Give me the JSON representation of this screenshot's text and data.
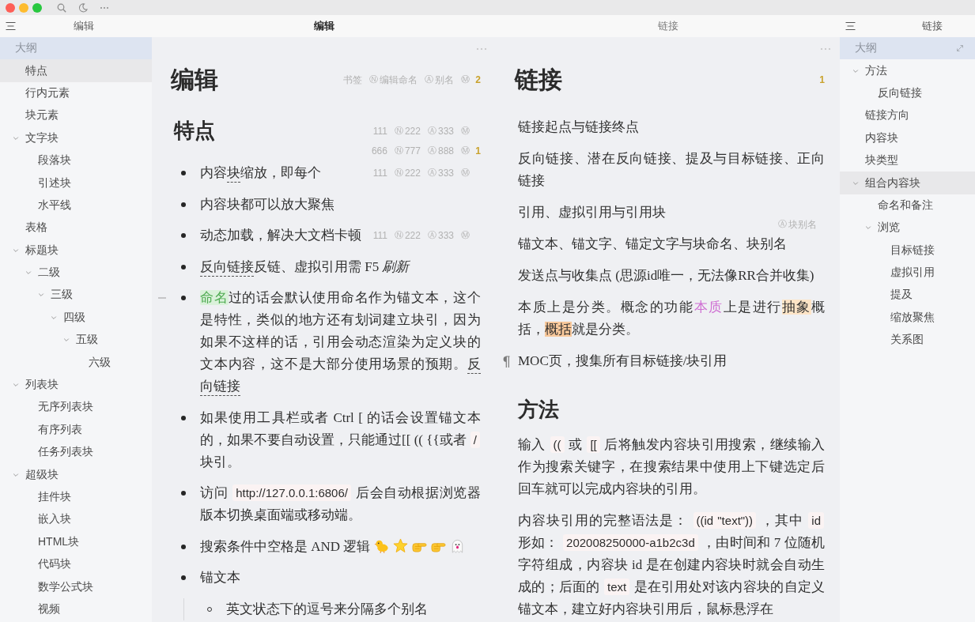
{
  "left_outline": {
    "header": "编辑",
    "title": "大纲",
    "items": [
      {
        "label": "特点",
        "selected": true
      },
      {
        "label": "行内元素",
        "selected": false
      },
      {
        "label": "块元素",
        "selected": false
      },
      {
        "label": "文字块",
        "selected": false,
        "expanded": true,
        "children": [
          {
            "label": "段落块",
            "selected": false
          },
          {
            "label": "引述块",
            "selected": false
          },
          {
            "label": "水平线",
            "selected": false
          }
        ]
      },
      {
        "label": "表格",
        "selected": false
      },
      {
        "label": "标题块",
        "selected": false,
        "expanded": true,
        "children": [
          {
            "label": "二级",
            "selected": false,
            "expanded": true,
            "children": [
              {
                "label": "三级",
                "selected": false,
                "expanded": true,
                "children": [
                  {
                    "label": "四级",
                    "selected": false,
                    "expanded": true,
                    "children": [
                      {
                        "label": "五级",
                        "selected": false,
                        "expanded": true,
                        "children": [
                          {
                            "label": "六级",
                            "selected": false
                          }
                        ]
                      }
                    ]
                  }
                ]
              }
            ]
          }
        ]
      },
      {
        "label": "列表块",
        "selected": false,
        "expanded": true,
        "children": [
          {
            "label": "无序列表块",
            "selected": false
          },
          {
            "label": "有序列表",
            "selected": false
          },
          {
            "label": "任务列表块",
            "selected": false
          }
        ]
      },
      {
        "label": "超级块",
        "selected": false,
        "expanded": true,
        "children": [
          {
            "label": "挂件块",
            "selected": false
          },
          {
            "label": "嵌入块",
            "selected": false
          },
          {
            "label": "HTML块",
            "selected": false
          },
          {
            "label": "代码块",
            "selected": false
          },
          {
            "label": "数学公式块",
            "selected": false
          },
          {
            "label": "视频",
            "selected": false
          }
        ]
      }
    ]
  },
  "editors": [
    {
      "tab": "编辑",
      "active": true,
      "title": "编辑",
      "attrs": [
        {
          "text": "书签"
        },
        {
          "glyph": "Ⓝ",
          "text": "编辑命名"
        },
        {
          "glyph": "Ⓐ",
          "text": "别名"
        },
        {
          "glyph": "Ⓜ"
        }
      ],
      "count": "2",
      "blocks": [
        {
          "kind": "heading",
          "text": "特点",
          "attrs": [
            {
              "text": "111"
            },
            {
              "glyph": "Ⓝ",
              "text": "222"
            },
            {
              "glyph": "Ⓐ",
              "text": "333"
            },
            {
              "glyph": "Ⓜ"
            }
          ]
        },
        {
          "kind": "list",
          "attrs": [
            {
              "text": "666"
            },
            {
              "glyph": "Ⓝ",
              "text": "777"
            },
            {
              "glyph": "Ⓐ",
              "text": "888"
            },
            {
              "glyph": "Ⓜ"
            }
          ],
          "count": "1",
          "items": [
            {
              "hovered": false,
              "segments": [
                {
                  "kind": "plain",
                  "text": "内容"
                },
                {
                  "kind": "ref",
                  "text": "块"
                },
                {
                  "kind": "plain",
                  "text": "缩放，即每个"
                }
              ],
              "attrs": [
                {
                  "text": "111"
                },
                {
                  "glyph": "Ⓝ",
                  "text": "222"
                },
                {
                  "glyph": "Ⓐ",
                  "text": "333"
                },
                {
                  "glyph": "Ⓜ"
                }
              ]
            },
            {
              "hovered": false,
              "text": "内容块都可以放大聚焦"
            },
            {
              "hovered": false,
              "text": "动态加载，解决大文档卡顿",
              "attrs": [
                {
                  "text": "111"
                },
                {
                  "glyph": "Ⓝ",
                  "text": "222"
                },
                {
                  "glyph": "Ⓐ",
                  "text": "333"
                },
                {
                  "glyph": "Ⓜ"
                }
              ]
            },
            {
              "hovered": false,
              "segments": [
                {
                  "kind": "ref",
                  "text": "反向链接"
                },
                {
                  "kind": "plain",
                  "text": "反链、虚拟引用需 F5 *刷新*"
                }
              ]
            },
            {
              "hovered": true,
              "segments": [
                {
                  "kind": "named",
                  "text": "命名"
                },
                {
                  "kind": "plain",
                  "text": "过的话会默认使用命名作为锚文本，这个是特性，类似的地方还有划词建立块引，因为如果不这样的话，引用会动态渲染为定义块的文本内容，这不是大部分使用场景的预期。"
                },
                {
                  "kind": "ref",
                  "text": "反向链接"
                }
              ]
            },
            {
              "hovered": false,
              "segments": [
                {
                  "kind": "plain",
                  "text": "如果使用工具栏或者 Ctrl [ 的话会设置锚文本的，如果不要自动设置，只能通过[[ (( {{或者 "
                },
                {
                  "kind": "code",
                  "text": "/"
                },
                {
                  "kind": "plain",
                  "text": " 块引。"
                }
              ]
            },
            {
              "hovered": false,
              "segments": [
                {
                  "kind": "plain",
                  "text": "访问 "
                },
                {
                  "kind": "code",
                  "text": "http://127.0.0.1:6806/"
                },
                {
                  "kind": "plain",
                  "text": " 后会自动根据浏览器版本切换桌面端或移动端。"
                }
              ]
            },
            {
              "hovered": false,
              "segments": [
                {
                  "kind": "plain",
                  "text": "搜索条件中空格是 AND 逻辑"
                },
                {
                  "kind": "chick"
                },
                {
                  "kind": "star"
                },
                {
                  "kind": "hand"
                },
                {
                  "kind": "hand"
                },
                {
                  "kind": "ghost"
                }
              ]
            },
            {
              "hovered": false,
              "text": "锚文本",
              "children": [
                {
                  "hovered": false,
                  "text": "英文状态下的逗号来分隔多个别名"
                }
              ]
            }
          ]
        }
      ]
    },
    {
      "tab": "链接",
      "active": false,
      "title": "链接",
      "count": "1",
      "blocks": [
        {
          "kind": "paragraph",
          "hovered": false,
          "text": "链接起点与链接终点"
        },
        {
          "kind": "paragraph",
          "hovered": false,
          "text": "反向链接、潜在反向链接、提及与目标链接、正向链接"
        },
        {
          "kind": "paragraph",
          "hovered": false,
          "text": "引用、虚拟引用与引用块"
        },
        {
          "kind": "paragraph",
          "hovered": false,
          "attrs": [
            {
              "glyph": "Ⓐ",
              "text": "块别名"
            }
          ],
          "text": "锚文本、锚文字、锚定文字与块命名、块别名"
        },
        {
          "kind": "paragraph",
          "hovered": false,
          "text": "发送点与收集点 (思源id唯一，无法像RR合并收集)"
        },
        {
          "kind": "paragraph",
          "hovered": false,
          "segments": [
            {
              "kind": "plain",
              "text": "本质上是分类。概念的功能"
            },
            {
              "kind": "colored",
              "text": "本质"
            },
            {
              "kind": "plain",
              "text": "上是进行"
            },
            {
              "kind": "mark",
              "text": "抽象"
            },
            {
              "kind": "plain",
              "text": "概括，"
            },
            {
              "kind": "mark-strong",
              "text": "概括"
            },
            {
              "kind": "plain",
              "text": "就是分类。"
            }
          ]
        },
        {
          "kind": "paragraph",
          "hovered": true,
          "text": "MOC页，搜集所有目标链接/块引用"
        },
        {
          "kind": "heading",
          "text": "方法"
        },
        {
          "kind": "paragraph",
          "hovered": false,
          "segments": [
            {
              "kind": "plain",
              "text": "输入 "
            },
            {
              "kind": "code",
              "text": "(("
            },
            {
              "kind": "plain",
              "text": " 或 "
            },
            {
              "kind": "code",
              "text": "[["
            },
            {
              "kind": "plain",
              "text": " 后将触发内容块引用搜索，继续输入作为搜索关键字，在搜索结果中使用上下键选定后回车就可以完成内容块的引用。"
            }
          ]
        },
        {
          "kind": "paragraph",
          "hovered": false,
          "segments": [
            {
              "kind": "plain",
              "text": "内容块引用的完整语法是： "
            },
            {
              "kind": "code",
              "text": "((id \"text\"))"
            },
            {
              "kind": "plain",
              "text": " ，其中 "
            },
            {
              "kind": "code",
              "text": "id"
            },
            {
              "kind": "plain",
              "text": " 形如： "
            },
            {
              "kind": "code",
              "text": "202008250000-a1b2c3d"
            },
            {
              "kind": "plain",
              "text": " ，由时间和 7 位随机字符组成，内容块 id 是在创建内容块时就会自动生成的；后面的 "
            },
            {
              "kind": "code",
              "text": "text"
            },
            {
              "kind": "plain",
              "text": " 是在引用处对该内容块的自定义锚文本，建立好内容块引用后，鼠标悬浮在"
            }
          ]
        }
      ]
    }
  ],
  "right_outline": {
    "header": "链接",
    "title": "大纲",
    "items": [
      {
        "label": "方法",
        "selected": false,
        "expanded": true,
        "children": [
          {
            "label": "反向链接",
            "selected": false
          }
        ]
      },
      {
        "label": "链接方向",
        "selected": false
      },
      {
        "label": "内容块",
        "selected": false
      },
      {
        "label": "块类型",
        "selected": false
      },
      {
        "label": "组合内容块",
        "selected": true,
        "expanded": true,
        "children": [
          {
            "label": "命名和备注",
            "selected": false
          },
          {
            "label": "浏览",
            "selected": false,
            "expanded": true,
            "children": [
              {
                "label": "目标链接",
                "selected": false
              },
              {
                "label": "虚拟引用",
                "selected": false
              },
              {
                "label": "提及",
                "selected": false
              },
              {
                "label": "缩放聚焦",
                "selected": false
              },
              {
                "label": "关系图",
                "selected": false
              }
            ]
          }
        ]
      }
    ]
  }
}
